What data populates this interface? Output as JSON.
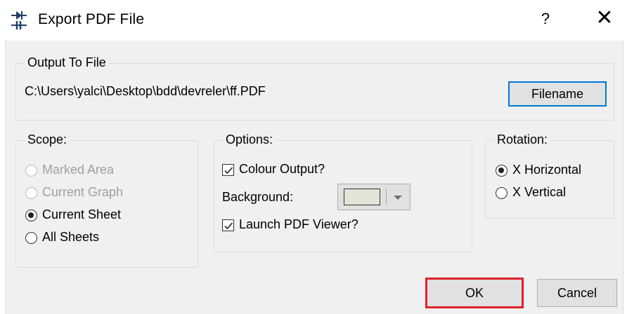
{
  "window": {
    "title": "Export PDF File",
    "help_glyph": "?",
    "close_glyph": "✕"
  },
  "output": {
    "legend": "Output To File",
    "path": "C:\\Users\\yalci\\Desktop\\bdd\\devreler\\ff.PDF",
    "filename_button": "Filename"
  },
  "scope": {
    "legend": "Scope:",
    "items": [
      {
        "label": "Marked Area",
        "checked": false,
        "disabled": true
      },
      {
        "label": "Current Graph",
        "checked": false,
        "disabled": true
      },
      {
        "label": "Current Sheet",
        "checked": true,
        "disabled": false
      },
      {
        "label": "All Sheets",
        "checked": false,
        "disabled": false
      }
    ]
  },
  "options": {
    "legend": "Options:",
    "colour_output": {
      "label": "Colour Output?",
      "checked": true
    },
    "background_label": "Background:",
    "background_color": "#e3e4d6",
    "launch_viewer": {
      "label": "Launch PDF Viewer?",
      "checked": true
    }
  },
  "rotation": {
    "legend": "Rotation:",
    "items": [
      {
        "label": "X Horizontal",
        "checked": true
      },
      {
        "label": "X Vertical",
        "checked": false
      }
    ]
  },
  "buttons": {
    "ok": "OK",
    "cancel": "Cancel"
  },
  "colors": {
    "default_button_border": "#0078d7",
    "highlight_border": "#e0202a"
  }
}
